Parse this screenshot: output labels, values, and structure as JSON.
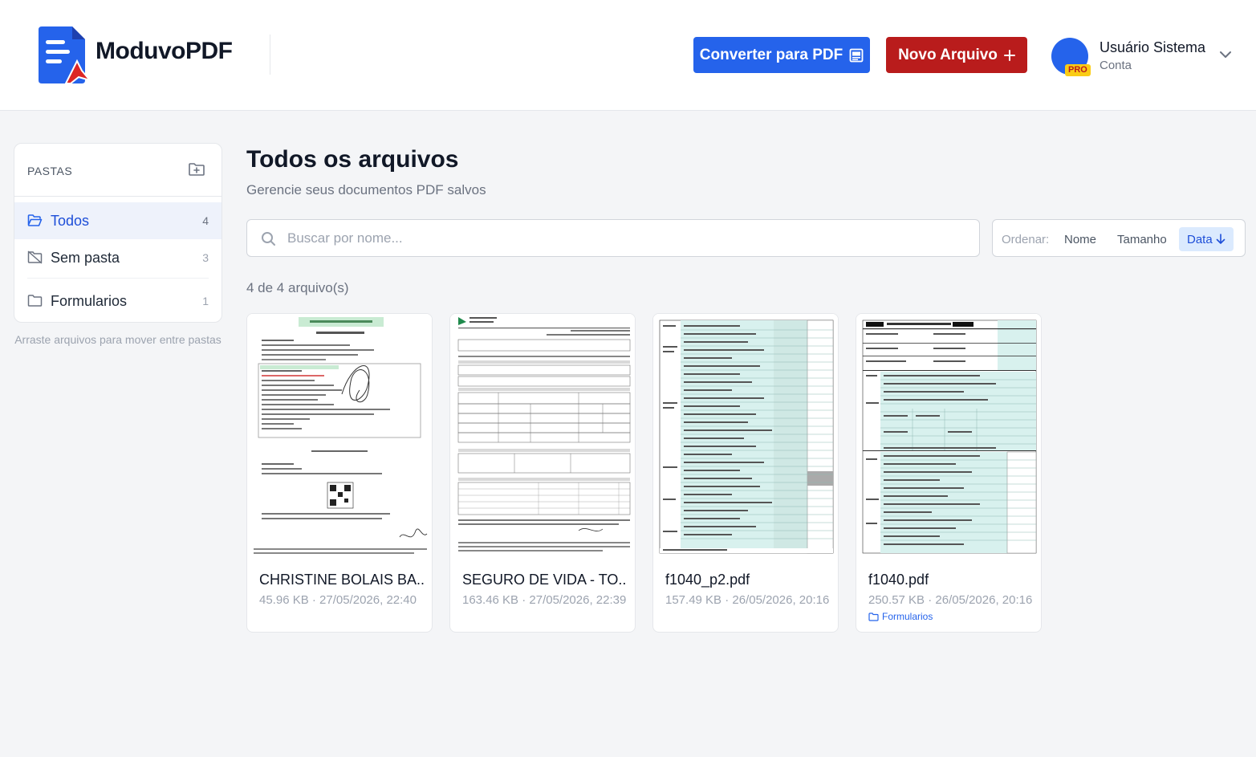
{
  "header": {
    "logo_text": "ModuvoPDF",
    "convert_button": "Converter para PDF",
    "new_button": "Novo Arquivo",
    "user": {
      "name": "Usuário Sistema",
      "subtitle": "Conta",
      "badge": "PRO"
    }
  },
  "sidebar": {
    "title": "PASTAS",
    "folders": [
      {
        "label": "Todos",
        "count": "4",
        "active": true
      },
      {
        "label": "Sem pasta",
        "count": "3",
        "active": false
      },
      {
        "label": "Formularios",
        "count": "1",
        "active": false
      }
    ],
    "hint": "Arraste arquivos para mover entre pastas"
  },
  "main": {
    "title": "Todos os arquivos",
    "subtitle": "Gerencie seus documentos PDF salvos",
    "search": {
      "placeholder": "Buscar por nome...",
      "value": ""
    },
    "sort": {
      "label": "Ordenar:",
      "options": [
        {
          "label": "Nome",
          "active": false
        },
        {
          "label": "Tamanho",
          "active": false
        },
        {
          "label": "Data",
          "active": true
        }
      ]
    },
    "count_text": "4 de 4 arquivo(s)",
    "files": [
      {
        "name": "CHRISTINE BOLAIS BA...",
        "meta": "45.96 KB · 27/05/2026, 22:40",
        "folder": ""
      },
      {
        "name": "SEGURO DE VIDA - TO...",
        "meta": "163.46 KB · 27/05/2026, 22:39",
        "folder": ""
      },
      {
        "name": "f1040_p2.pdf",
        "meta": "157.49 KB · 26/05/2026, 20:16",
        "folder": ""
      },
      {
        "name": "f1040.pdf",
        "meta": "250.57 KB · 26/05/2026, 20:16",
        "folder": "Formularios"
      }
    ]
  },
  "colors": {
    "primary": "#2563eb",
    "danger": "#b91c1c",
    "form_tint": "#d8f1ee"
  }
}
